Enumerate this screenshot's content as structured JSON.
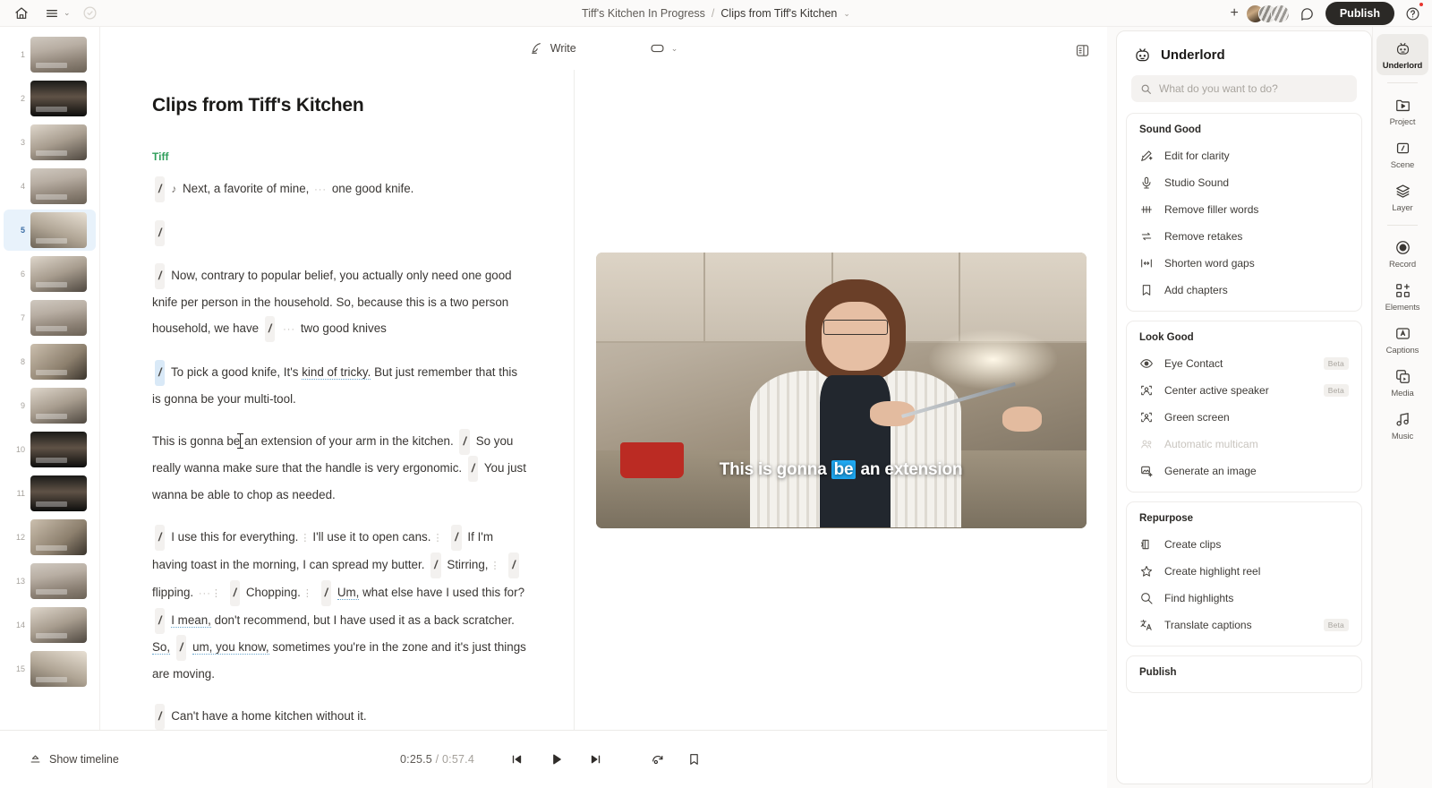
{
  "topbar": {
    "home_icon": "home-icon",
    "menu_icon": "hamburger-menu-icon",
    "chevron": "⌄",
    "status_icon": "check-circle-icon",
    "breadcrumb": {
      "project": "Tiff's Kitchen In Progress",
      "separator": "/",
      "document": "Clips from Tiff's Kitchen",
      "chevron": "⌄"
    },
    "add_label": "+",
    "comment_icon": "comment-icon",
    "publish_label": "Publish",
    "help_icon": "help-circle-icon"
  },
  "doc_toolbar": {
    "write_label": "Write",
    "write_icon": "pen-feather-icon",
    "view_icon": "caption-box-icon",
    "view_chevron": "⌄",
    "panel_toggle_icon": "panel-layout-icon"
  },
  "thumbnails": [
    {
      "num": "1",
      "style": "tk-a"
    },
    {
      "num": "2",
      "style": "tk-b"
    },
    {
      "num": "3",
      "style": "tk-c"
    },
    {
      "num": "4",
      "style": "tk-a"
    },
    {
      "num": "5",
      "style": "tk-d"
    },
    {
      "num": "6",
      "style": "tk-c"
    },
    {
      "num": "7",
      "style": "tk-a"
    },
    {
      "num": "8",
      "style": "tk-e"
    },
    {
      "num": "9",
      "style": "tk-c"
    },
    {
      "num": "10",
      "style": "tk-b"
    },
    {
      "num": "11",
      "style": "tk-b"
    },
    {
      "num": "12",
      "style": "tk-e"
    },
    {
      "num": "13",
      "style": "tk-a"
    },
    {
      "num": "14",
      "style": "tk-c"
    },
    {
      "num": "15",
      "style": "tk-d"
    }
  ],
  "active_thumbnail": "5",
  "editor": {
    "title": "Clips from Tiff's Kitchen",
    "speaker": "Tiff",
    "clip_mark": "/",
    "music_note": "♪",
    "p1_text": "Next, a favorite of mine,",
    "p1_text2": "one good knife.",
    "p3_a": "Now, contrary to popular belief, you actually only need one good knife per person in the household. So, because this is a two person household, we have",
    "p3_b": "two good knives",
    "p4_a": "To pick a good knife, It's",
    "p4_filler": "kind of tricky.",
    "p4_b": "But just remember that this is gonna be your multi-tool.",
    "p5_a": "This is gonna be",
    "p5_b": "an extension of your arm in the kitchen.",
    "p5_c": "So you really wanna make sure that the handle is very ergonomic.",
    "p5_d": "You just wanna be able to chop as needed.",
    "p6_a": "I use this for everything.",
    "p6_b": "I'll use it to open cans.",
    "p6_c": "If I'm having toast in the morning, I can spread my butter.",
    "p6_d": "Stirring,",
    "p6_e": "flipping.",
    "p6_f": "Chopping.",
    "p6_g": "Um,",
    "p6_h": "what else have I used this for?",
    "p6_i": "I mean,",
    "p6_j": "don't recommend, but I have used it as a back scratcher.",
    "p6_k": "So,",
    "p6_l": "um, you know,",
    "p6_m": "sometimes you're in the zone and it's just things are moving.",
    "p7": "Can't have a home kitchen without it."
  },
  "video": {
    "caption_before": "This is gonna",
    "caption_highlight": "be",
    "caption_after": "an extension",
    "highlight_color": "#1ea7f0"
  },
  "bottombar": {
    "show_timeline_label": "Show timeline",
    "timeline_icon": "timeline-icon",
    "current_time": "0:25.5",
    "time_separator": "/",
    "total_time": "0:57.4",
    "prev_icon": "skip-back-icon",
    "play_icon": "play-icon",
    "next_icon": "skip-forward-icon",
    "loop_icon": "loop-icon",
    "bookmark_icon": "bookmark-icon"
  },
  "underlord": {
    "title": "Underlord",
    "robot_icon": "robot-icon",
    "search_placeholder": "What do you want to do?",
    "search_icon": "search-icon",
    "groups": [
      {
        "title": "Sound Good",
        "items": [
          {
            "label": "Edit for clarity",
            "icon": "pencil-sparkle-icon",
            "badge": "",
            "disabled": false
          },
          {
            "label": "Studio Sound",
            "icon": "microphone-sparkle-icon",
            "badge": "",
            "disabled": false
          },
          {
            "label": "Remove filler words",
            "icon": "strikethrough-icon",
            "badge": "",
            "disabled": false
          },
          {
            "label": "Remove retakes",
            "icon": "swap-arrows-icon",
            "badge": "",
            "disabled": false
          },
          {
            "label": "Shorten word gaps",
            "icon": "width-arrows-icon",
            "badge": "",
            "disabled": false
          },
          {
            "label": "Add chapters",
            "icon": "bookmark-icon",
            "badge": "",
            "disabled": false
          }
        ]
      },
      {
        "title": "Look Good",
        "items": [
          {
            "label": "Eye Contact",
            "icon": "eye-icon",
            "badge": "Beta",
            "disabled": false
          },
          {
            "label": "Center active speaker",
            "icon": "person-frame-icon",
            "badge": "Beta",
            "disabled": false
          },
          {
            "label": "Green screen",
            "icon": "person-crop-icon",
            "badge": "",
            "disabled": false
          },
          {
            "label": "Automatic multicam",
            "icon": "people-icon",
            "badge": "",
            "disabled": true
          },
          {
            "label": "Generate an image",
            "icon": "image-sparkle-icon",
            "badge": "",
            "disabled": false
          }
        ]
      },
      {
        "title": "Repurpose",
        "items": [
          {
            "label": "Create clips",
            "icon": "clip-icon",
            "badge": "",
            "disabled": false
          },
          {
            "label": "Create highlight reel",
            "icon": "star-icon",
            "badge": "",
            "disabled": false
          },
          {
            "label": "Find highlights",
            "icon": "search-icon",
            "badge": "",
            "disabled": false
          },
          {
            "label": "Translate captions",
            "icon": "translate-icon",
            "badge": "Beta",
            "disabled": false
          }
        ]
      },
      {
        "title": "Publish",
        "items": []
      }
    ]
  },
  "rail": [
    {
      "label": "Underlord",
      "icon": "robot-icon",
      "active": true
    },
    {
      "label": "Project",
      "icon": "folder-play-icon",
      "active": false
    },
    {
      "label": "Scene",
      "icon": "scene-icon",
      "active": false
    },
    {
      "label": "Layer",
      "icon": "layers-icon",
      "active": false
    },
    {
      "label": "Record",
      "icon": "record-icon",
      "active": false
    },
    {
      "label": "Elements",
      "icon": "elements-icon",
      "active": false
    },
    {
      "label": "Captions",
      "icon": "captions-icon",
      "active": false
    },
    {
      "label": "Media",
      "icon": "media-icon",
      "active": false
    },
    {
      "label": "Music",
      "icon": "music-icon",
      "active": false
    }
  ]
}
